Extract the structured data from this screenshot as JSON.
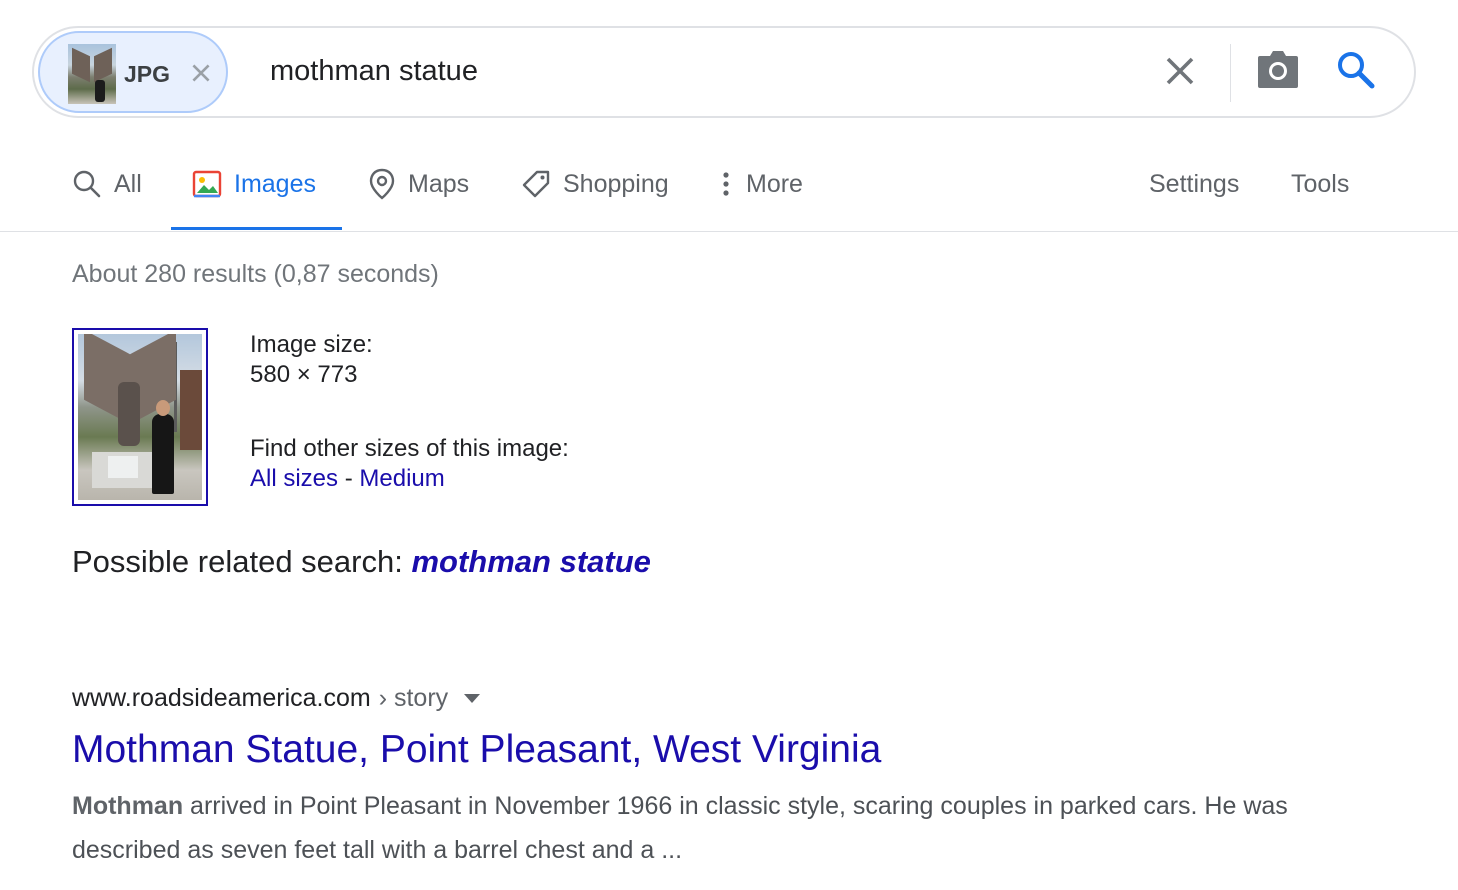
{
  "search": {
    "chip_label": "JPG",
    "query": "mothman statue"
  },
  "tabs": [
    {
      "label": "All",
      "icon": "search-icon"
    },
    {
      "label": "Images",
      "icon": "image-icon",
      "active": true
    },
    {
      "label": "Maps",
      "icon": "map-pin-icon"
    },
    {
      "label": "Shopping",
      "icon": "tag-icon"
    },
    {
      "label": "More",
      "icon": "more-vert-icon"
    }
  ],
  "tools": {
    "settings": "Settings",
    "tools": "Tools"
  },
  "results": {
    "stats": "About 280 results (0,87 seconds)",
    "image_size_label": "Image size:",
    "image_size_value": "580 × 773",
    "find_other_label": "Find other sizes of this image:",
    "all_sizes": "All sizes",
    "separator": "-",
    "medium": "Medium",
    "related_label": "Possible related search:",
    "related_query": "mothman statue"
  },
  "result1": {
    "domain": "www.roadsideamerica.com",
    "path": "› story",
    "title": "Mothman Statue, Point Pleasant, West Virginia",
    "snippet_bold": "Mothman",
    "snippet_rest": " arrived in Point Pleasant in November 1966 in classic style, scaring couples in parked cars. He was described as seven feet tall with a barrel chest and a ..."
  },
  "colors": {
    "accent": "#1a73e8",
    "link": "#1a0dab",
    "muted": "#70757a",
    "border": "#dfe1e5"
  }
}
